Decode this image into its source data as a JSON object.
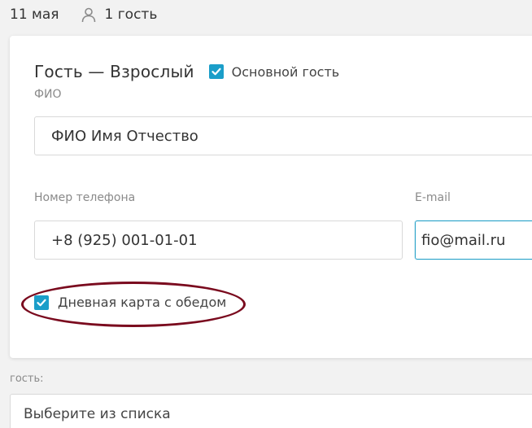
{
  "top_bar": {
    "date": "11 мая",
    "guests_count": "1 гость",
    "guest_icon": "person-icon"
  },
  "guest_card": {
    "title": "Гость — Взрослый",
    "main_guest_label": "Основной гость",
    "main_guest_checked": true,
    "fio": {
      "label": "ФИО",
      "value": "ФИО Имя Отчество"
    },
    "phone": {
      "label": "Номер телефона",
      "value": "+8 (925) 001-01-01"
    },
    "email": {
      "label": "E-mail",
      "value": "fio@mail.ru"
    },
    "day_card": {
      "label": "Дневная карта с обедом",
      "checked": true
    }
  },
  "bottom": {
    "label": "гость:",
    "select_placeholder": "Выберите из списка"
  },
  "colors": {
    "accent": "#1b9ec9",
    "highlight": "#7a0a1e",
    "background": "#f2f2f2"
  }
}
